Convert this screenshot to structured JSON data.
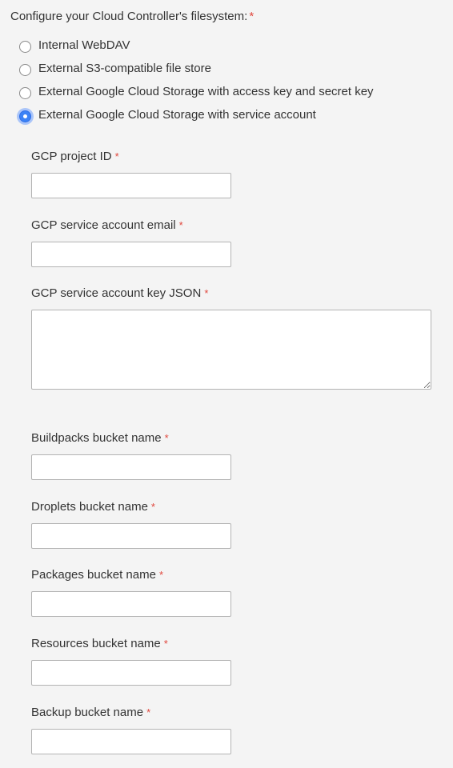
{
  "form": {
    "heading": "Configure your Cloud Controller's filesystem:",
    "required_marker": "*",
    "filesystem_options": [
      {
        "label": "Internal WebDAV",
        "selected": false
      },
      {
        "label": "External S3-compatible file store",
        "selected": false
      },
      {
        "label": "External Google Cloud Storage with access key and secret key",
        "selected": false
      },
      {
        "label": "External Google Cloud Storage with service account",
        "selected": true
      }
    ],
    "fields": {
      "gcp_project_id": {
        "label": "GCP project ID",
        "value": ""
      },
      "gcp_service_account_email": {
        "label": "GCP service account email",
        "value": ""
      },
      "gcp_service_account_key_json": {
        "label": "GCP service account key JSON",
        "value": ""
      },
      "buildpacks_bucket_name": {
        "label": "Buildpacks bucket name",
        "value": ""
      },
      "droplets_bucket_name": {
        "label": "Droplets bucket name",
        "value": ""
      },
      "packages_bucket_name": {
        "label": "Packages bucket name",
        "value": ""
      },
      "resources_bucket_name": {
        "label": "Resources bucket name",
        "value": ""
      },
      "backup_bucket_name": {
        "label": "Backup bucket name",
        "value": ""
      }
    }
  },
  "colors": {
    "background": "#f4f4f4",
    "required": "#e0473d",
    "radio_selected": "#3b82f6"
  }
}
